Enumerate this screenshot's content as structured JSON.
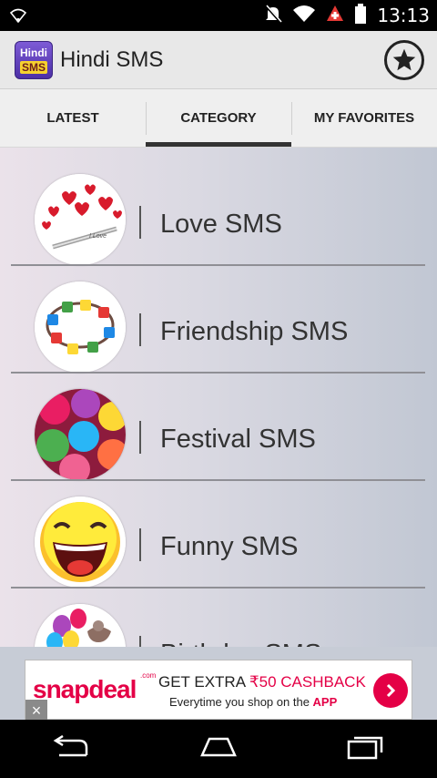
{
  "status_bar": {
    "time": "13:13"
  },
  "app": {
    "icon_line1": "Hindi",
    "icon_line2": "SMS",
    "title": "Hindi SMS"
  },
  "tabs": [
    {
      "label": "LATEST",
      "active": false
    },
    {
      "label": "CATEGORY",
      "active": true
    },
    {
      "label": "MY FAVORITES",
      "active": false
    }
  ],
  "categories": [
    {
      "label": "Love SMS",
      "image": "hearts-and-pen-image"
    },
    {
      "label": "Friendship SMS",
      "image": "friendship-band-image"
    },
    {
      "label": "Festival SMS",
      "image": "holi-colors-image"
    },
    {
      "label": "Funny SMS",
      "image": "laughing-smiley-image"
    },
    {
      "label": "Birthday SMS",
      "image": "birthday-balloons-image"
    }
  ],
  "ad": {
    "brand_main": "snapdeal",
    "brand_suffix": ".com",
    "line1_prefix": "GET  EXTRA ",
    "line1_amount": "₹50 CASHBACK",
    "line2_prefix": "Everytime you shop on the ",
    "line2_highlight": "APP",
    "close_label": "×"
  },
  "colors": {
    "accent": "#333333",
    "brand": "#e40046",
    "background_start": "#ebe2ea",
    "background_end": "#c1c7d3"
  }
}
